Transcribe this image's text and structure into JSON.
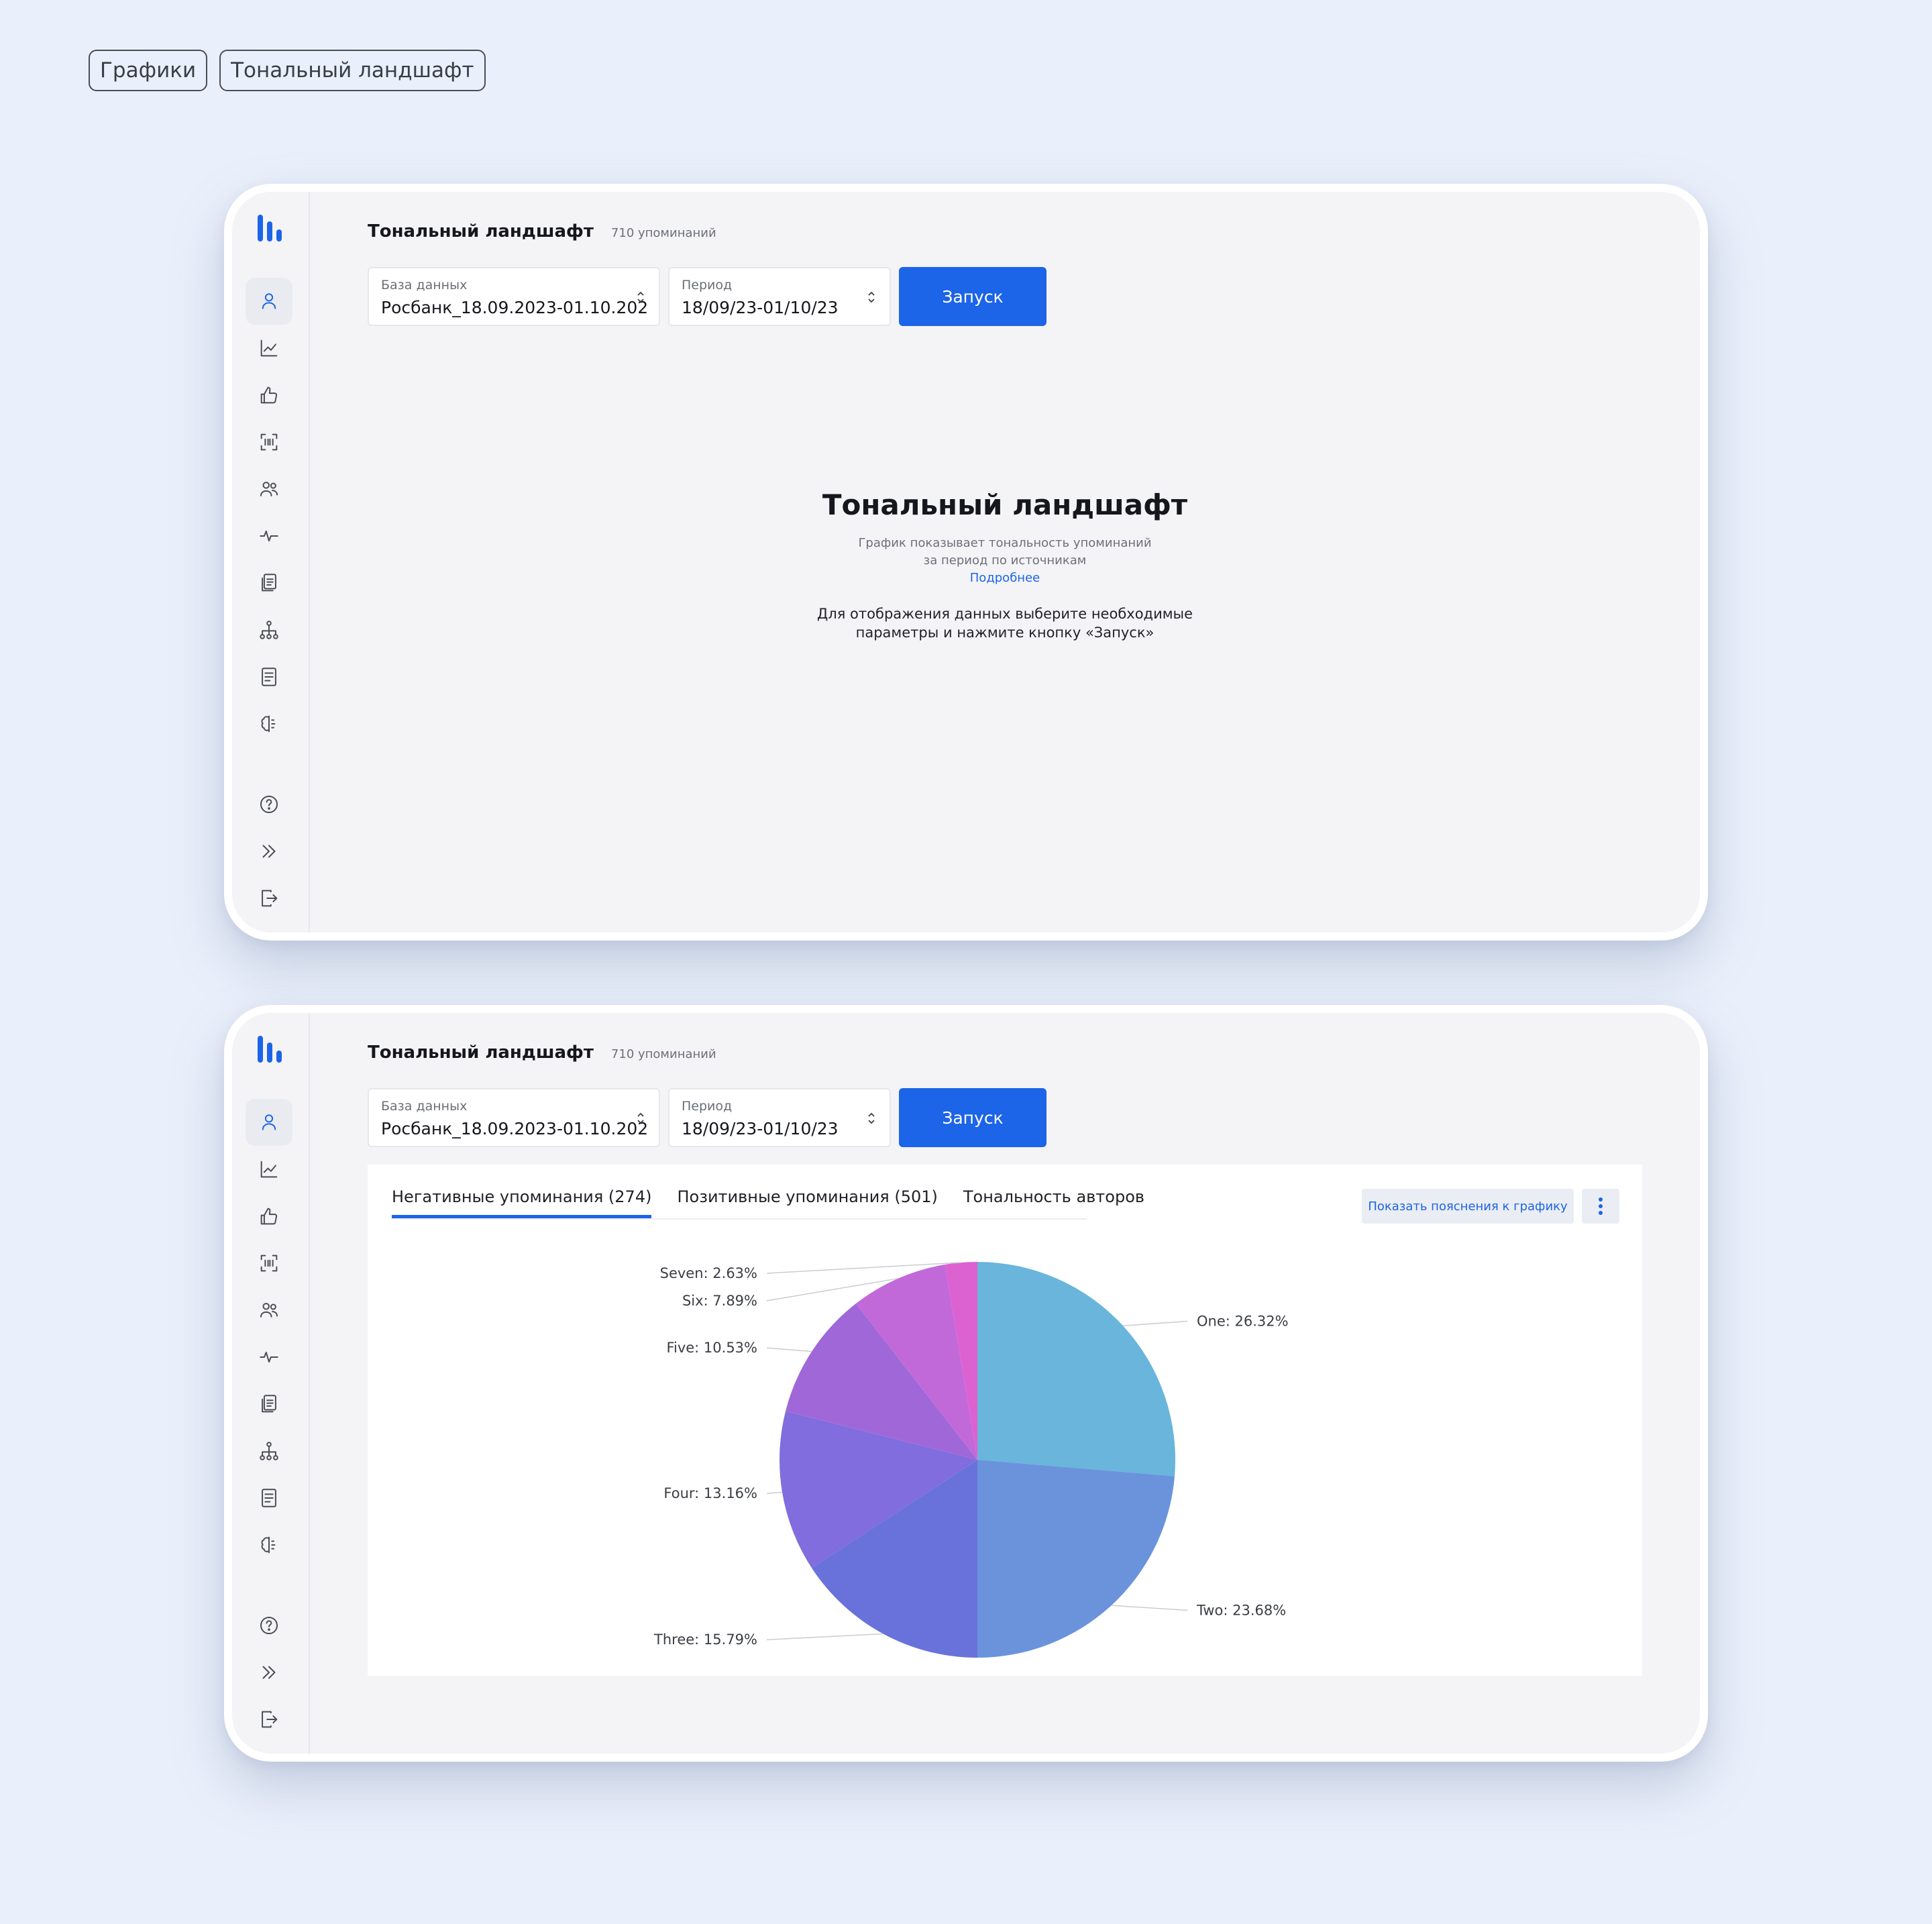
{
  "tags": [
    "Графики",
    "Тональный ландшафт"
  ],
  "screen": {
    "title": "Тональный ландшафт",
    "mentions_count": "710 упоминаний",
    "db_label": "База данных",
    "db_value": "Росбанк_18.09.2023-01.10.202",
    "period_label": "Период",
    "period_value": "18/09/23-01/10/23",
    "run_button": "Запуск"
  },
  "sidebar": {
    "top_icons": [
      "user-icon",
      "chart-line-icon",
      "thumbs-up-icon",
      "scan-icon",
      "users-icon",
      "pulse-icon",
      "documents-icon",
      "hierarchy-icon",
      "report-icon",
      "brain-icon"
    ],
    "bottom_icons": [
      "help-icon",
      "expand-icon",
      "logout-icon"
    ],
    "accent_color": "#1c64e8"
  },
  "empty_state": {
    "title": "Тональный ландшафт",
    "desc_line1": "График показывает тональность упоминаний",
    "desc_line2": "за период по источникам",
    "link": "Подробнее",
    "hint_line1": "Для отображения данных выберите необходимые",
    "hint_line2": "параметры и нажмите кнопку «Запуск»"
  },
  "tabs": [
    "Негативные упоминания (274)",
    "Позитивные упоминания (501)",
    "Тональность авторов"
  ],
  "explain_button": "Показать пояснения к графику",
  "chart_data": {
    "type": "pie",
    "slices": [
      {
        "label": "One: 26.32%",
        "value": 26.32,
        "color": "#69b5dc"
      },
      {
        "label": "Two: 23.68%",
        "value": 23.68,
        "color": "#6a93dc"
      },
      {
        "label": "Three: 15.79%",
        "value": 15.79,
        "color": "#6872da"
      },
      {
        "label": "Four: 13.16%",
        "value": 13.16,
        "color": "#816ddd"
      },
      {
        "label": "Five: 10.53%",
        "value": 10.53,
        "color": "#a067d8"
      },
      {
        "label": "Six: 7.89%",
        "value": 7.89,
        "color": "#c269da"
      },
      {
        "label": "Seven: 2.63%",
        "value": 2.63,
        "color": "#dc62d1"
      }
    ]
  }
}
